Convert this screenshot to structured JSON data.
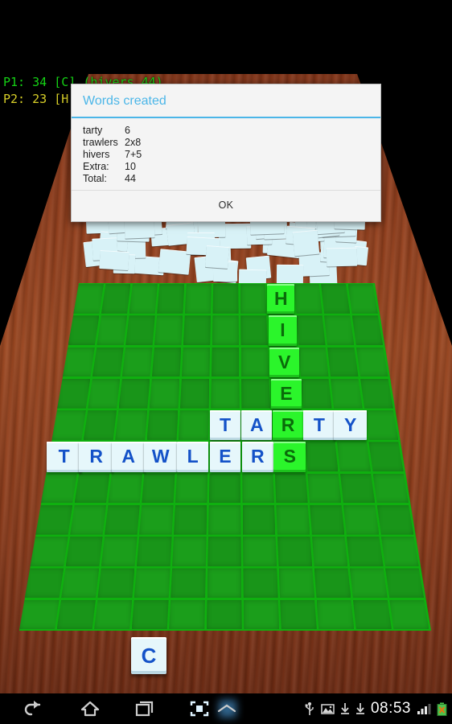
{
  "app": {
    "title": "Word game board",
    "background_color": "#000000",
    "table_color": "#8e3b1b",
    "board_color": "#1b9e1b"
  },
  "hud": {
    "player1": "P1: 34 [C] (hivers 44)",
    "player2": "P2: 23 [H",
    "player1_color": "#15d215",
    "player2_color": "#d8cf28"
  },
  "dialog": {
    "title": "Words created",
    "rows": [
      {
        "word": "tarty",
        "score": "6"
      },
      {
        "word": "trawlers",
        "score": "2x8"
      },
      {
        "word": "hivers",
        "score": "7+5"
      },
      {
        "word": "Extra:",
        "score": "10"
      },
      {
        "word": "Total:",
        "score": "44"
      }
    ],
    "ok_label": "OK",
    "accent_color": "#4bb6e8",
    "background_color": "#f4f4f4"
  },
  "board": {
    "columns": 11,
    "rows": 11,
    "placed_tiles": [
      {
        "letter": "H",
        "row": 0,
        "col": 7,
        "state": "new"
      },
      {
        "letter": "I",
        "row": 1,
        "col": 7,
        "state": "new"
      },
      {
        "letter": "V",
        "row": 2,
        "col": 7,
        "state": "new"
      },
      {
        "letter": "E",
        "row": 3,
        "col": 7,
        "state": "new"
      },
      {
        "letter": "T",
        "row": 4,
        "col": 5,
        "state": "placed"
      },
      {
        "letter": "A",
        "row": 4,
        "col": 6,
        "state": "placed"
      },
      {
        "letter": "R",
        "row": 4,
        "col": 7,
        "state": "new"
      },
      {
        "letter": "T",
        "row": 4,
        "col": 8,
        "state": "placed"
      },
      {
        "letter": "Y",
        "row": 4,
        "col": 9,
        "state": "placed"
      },
      {
        "letter": "T",
        "row": 5,
        "col": 0,
        "state": "placed"
      },
      {
        "letter": "R",
        "row": 5,
        "col": 1,
        "state": "placed"
      },
      {
        "letter": "A",
        "row": 5,
        "col": 2,
        "state": "placed"
      },
      {
        "letter": "W",
        "row": 5,
        "col": 3,
        "state": "placed"
      },
      {
        "letter": "L",
        "row": 5,
        "col": 4,
        "state": "placed"
      },
      {
        "letter": "E",
        "row": 5,
        "col": 5,
        "state": "placed"
      },
      {
        "letter": "R",
        "row": 5,
        "col": 6,
        "state": "placed"
      },
      {
        "letter": "S",
        "row": 5,
        "col": 7,
        "state": "new"
      }
    ],
    "words_on_board": [
      "HIVERS",
      "TARTY",
      "TRAWLERS"
    ],
    "placed_tile_color": "#e6f7fb",
    "placed_letter_color": "#1452c8",
    "new_tile_color": "#2bf52b",
    "new_letter_color": "#0a6b0a"
  },
  "rack": {
    "tiles": [
      {
        "letter": "C"
      }
    ]
  },
  "statusbar": {
    "time": "08:53",
    "icons": [
      "usb-icon",
      "image-icon",
      "download-icon",
      "download-icon",
      "signal-icon",
      "battery-error-icon"
    ]
  },
  "navbar": {
    "items": [
      {
        "name": "back-icon"
      },
      {
        "name": "home-icon"
      },
      {
        "name": "recents-icon"
      },
      {
        "name": "screenshot-icon"
      },
      {
        "name": "expand-icon"
      }
    ]
  }
}
